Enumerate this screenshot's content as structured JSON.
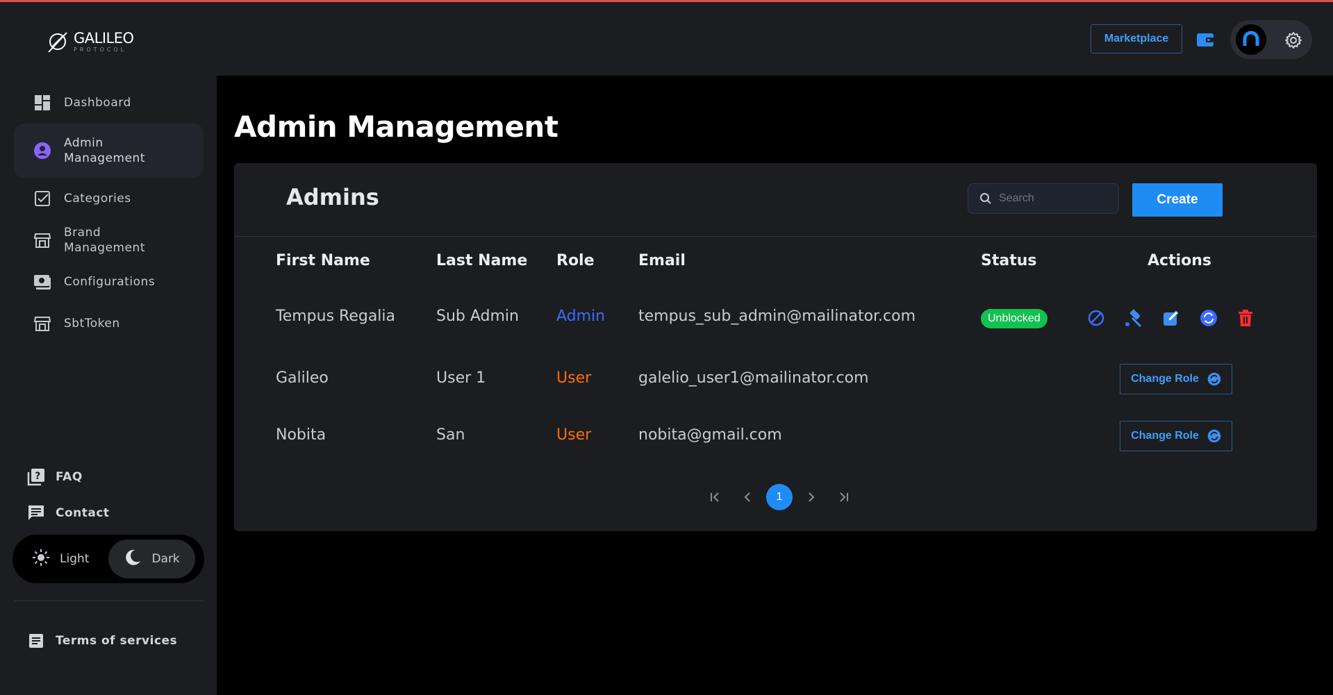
{
  "brand": {
    "title": "GALILEO",
    "subtitle": "PROTOCOL"
  },
  "sidebar": {
    "items": [
      {
        "label": "Dashboard",
        "icon": "dashboard-icon",
        "active": false
      },
      {
        "label": "Admin Management",
        "icon": "user-circle-icon",
        "active": true
      },
      {
        "label": "Categories",
        "icon": "checkbox-icon",
        "active": false
      },
      {
        "label": "Brand Management",
        "icon": "store-icon",
        "active": false
      },
      {
        "label": "Configurations",
        "icon": "configuration-icon",
        "active": false
      },
      {
        "label": "SbtToken",
        "icon": "store-icon",
        "active": false
      }
    ],
    "faq": "FAQ",
    "contact": "Contact",
    "theme": {
      "light": "Light",
      "dark": "Dark",
      "selected": "Dark"
    },
    "terms": "Terms of services"
  },
  "header": {
    "marketplace": "Marketplace"
  },
  "main": {
    "title": "Admin Management",
    "card_title": "Admins",
    "search_placeholder": "Search",
    "create_label": "Create",
    "columns": [
      "First Name",
      "Last Name",
      "Role",
      "Email",
      "Status",
      "Actions"
    ],
    "rows": [
      {
        "first": "Tempus Regalia",
        "last": "Sub Admin",
        "role": "Admin",
        "email": "tempus_sub_admin@mailinator.com",
        "status": "Unblocked"
      },
      {
        "first": "Galileo",
        "last": "User 1",
        "role": "User",
        "email": "galelio_user1@mailinator.com",
        "action": "Change Role"
      },
      {
        "first": "Nobita",
        "last": "San",
        "role": "User",
        "email": "nobita@gmail.com",
        "action": "Change Role"
      }
    ],
    "pagination": {
      "current": "1"
    }
  },
  "colors": {
    "accent": "#1f8cf4",
    "admin_role": "#3b6bff",
    "user_role": "#ff6b0e",
    "success": "#12c14f",
    "danger": "#ff2d2d"
  }
}
